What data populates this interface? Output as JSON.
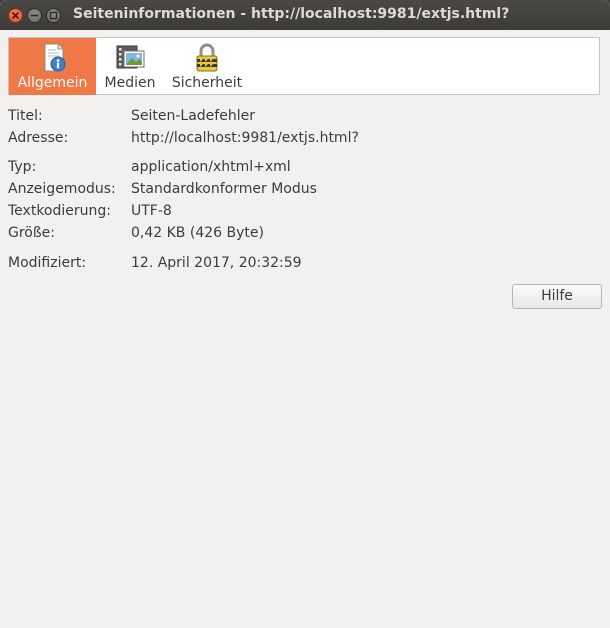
{
  "window": {
    "title": "Seiteninformationen - http://localhost:9981/extjs.html?"
  },
  "tabs": [
    {
      "label": "Allgemein",
      "icon": "info-page-icon",
      "active": true
    },
    {
      "label": "Medien",
      "icon": "media-film-icon",
      "active": false
    },
    {
      "label": "Sicherheit",
      "icon": "padlock-icon",
      "active": false
    }
  ],
  "info": {
    "title_label": "Titel:",
    "title_value": "Seiten-Ladefehler",
    "address_label": "Adresse:",
    "address_value": "http://localhost:9981/extjs.html?",
    "type_label": "Typ:",
    "type_value": "application/xhtml+xml",
    "mode_label": "Anzeigemodus:",
    "mode_value": "Standardkonformer Modus",
    "encoding_label": "Textkodierung:",
    "encoding_value": "UTF-8",
    "size_label": "Größe:",
    "size_value": "0,42 KB (426 Byte)",
    "modified_label": "Modifiziert:",
    "modified_value": "12. April 2017, 20:32:59"
  },
  "buttons": {
    "help_label": "Hilfe"
  },
  "colors": {
    "titlebar": "#3c3b37",
    "active_tab": "#f07746",
    "close_button": "#e05a2c",
    "window_bg": "#f2f1f0"
  }
}
